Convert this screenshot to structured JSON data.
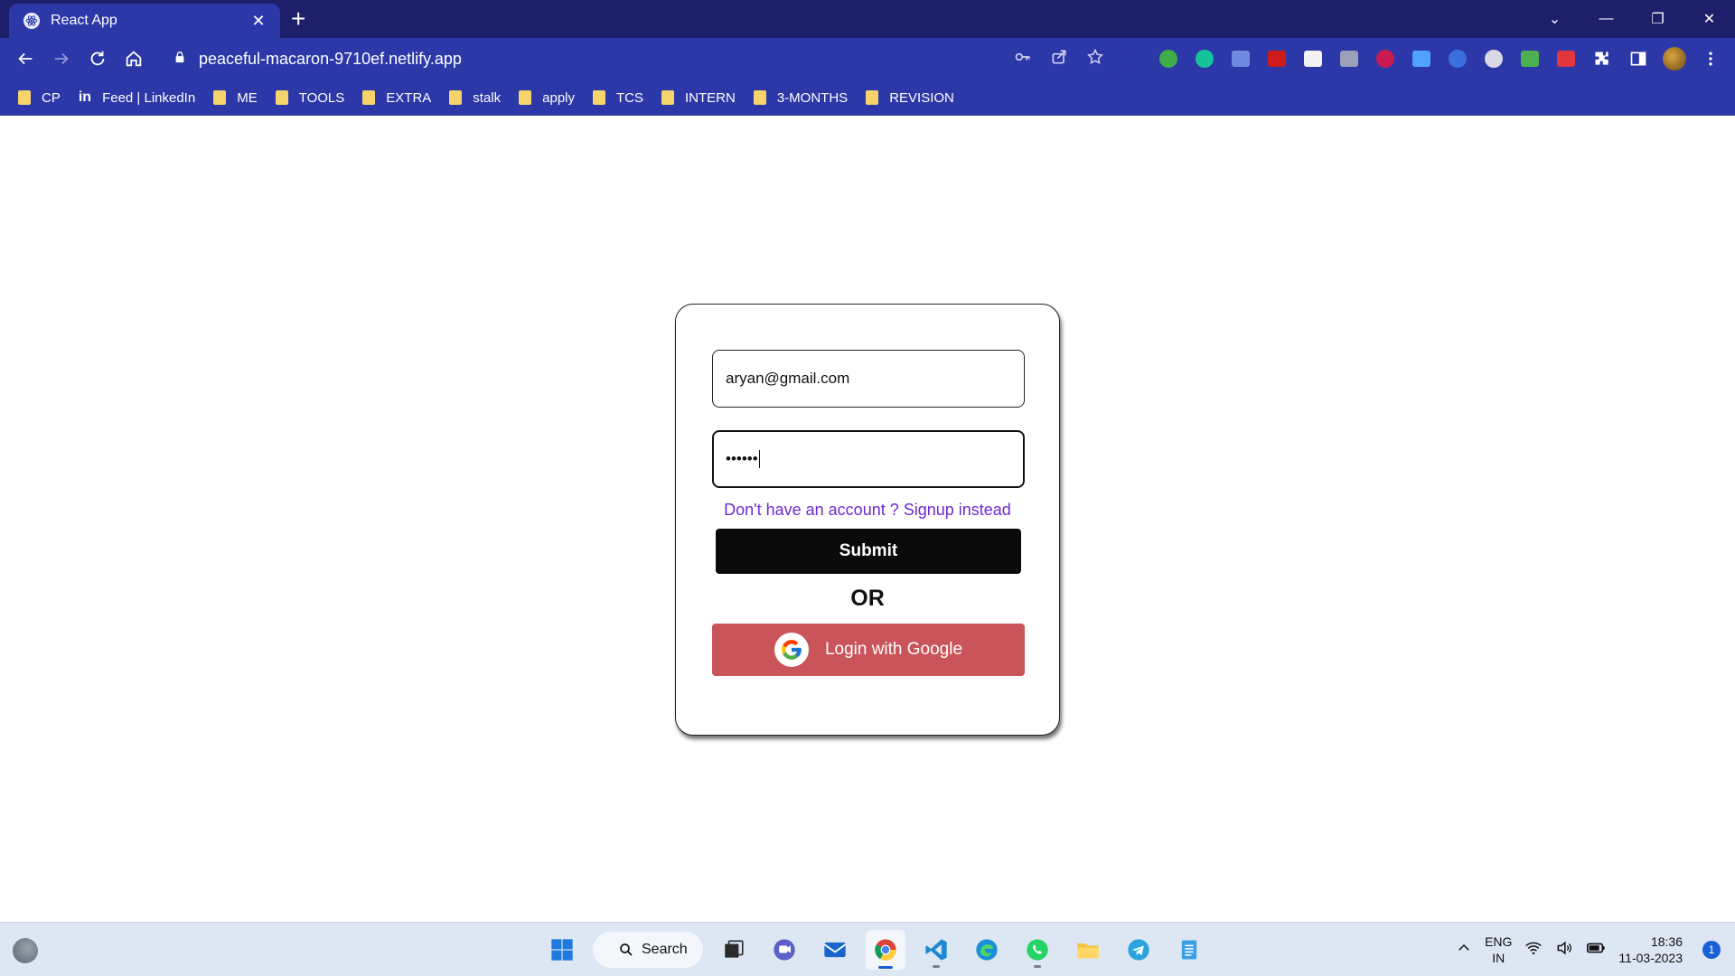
{
  "browser": {
    "tab_title": "React App",
    "tab_close": "✕",
    "new_tab": "+",
    "url": "peaceful-macaron-9710ef.netlify.app",
    "window_controls": {
      "expand": "⌄",
      "minimize": "—",
      "restore": "❐",
      "close": "✕"
    }
  },
  "bookmarks": [
    {
      "label": "CP",
      "icon": "folder-icon"
    },
    {
      "label": "Feed | LinkedIn",
      "icon": "linkedin-icon"
    },
    {
      "label": "ME",
      "icon": "folder-icon"
    },
    {
      "label": "TOOLS",
      "icon": "folder-icon"
    },
    {
      "label": "EXTRA",
      "icon": "folder-icon"
    },
    {
      "label": "stalk",
      "icon": "folder-icon"
    },
    {
      "label": "apply",
      "icon": "folder-icon"
    },
    {
      "label": "TCS",
      "icon": "folder-icon"
    },
    {
      "label": "INTERN",
      "icon": "folder-icon"
    },
    {
      "label": "3-MONTHS",
      "icon": "folder-icon"
    },
    {
      "label": "REVISION",
      "icon": "folder-icon"
    }
  ],
  "login": {
    "email_value": "aryan@gmail.com",
    "password_mask": "••••••",
    "signup_text": "Don't have an account ? Signup instead",
    "submit_label": "Submit",
    "or_text": "OR",
    "google_label": "Login with Google"
  },
  "taskbar": {
    "search_label": "Search",
    "lang_line1": "ENG",
    "lang_line2": "IN",
    "time": "18:36",
    "date": "11-03-2023",
    "notification_count": "1"
  },
  "colors": {
    "chrome_dark": "#1e1f6a",
    "chrome": "#2c37a8",
    "signup_link": "#6f2ad3",
    "google_button": "#c9555a",
    "submit_button": "#0a0a0a"
  }
}
